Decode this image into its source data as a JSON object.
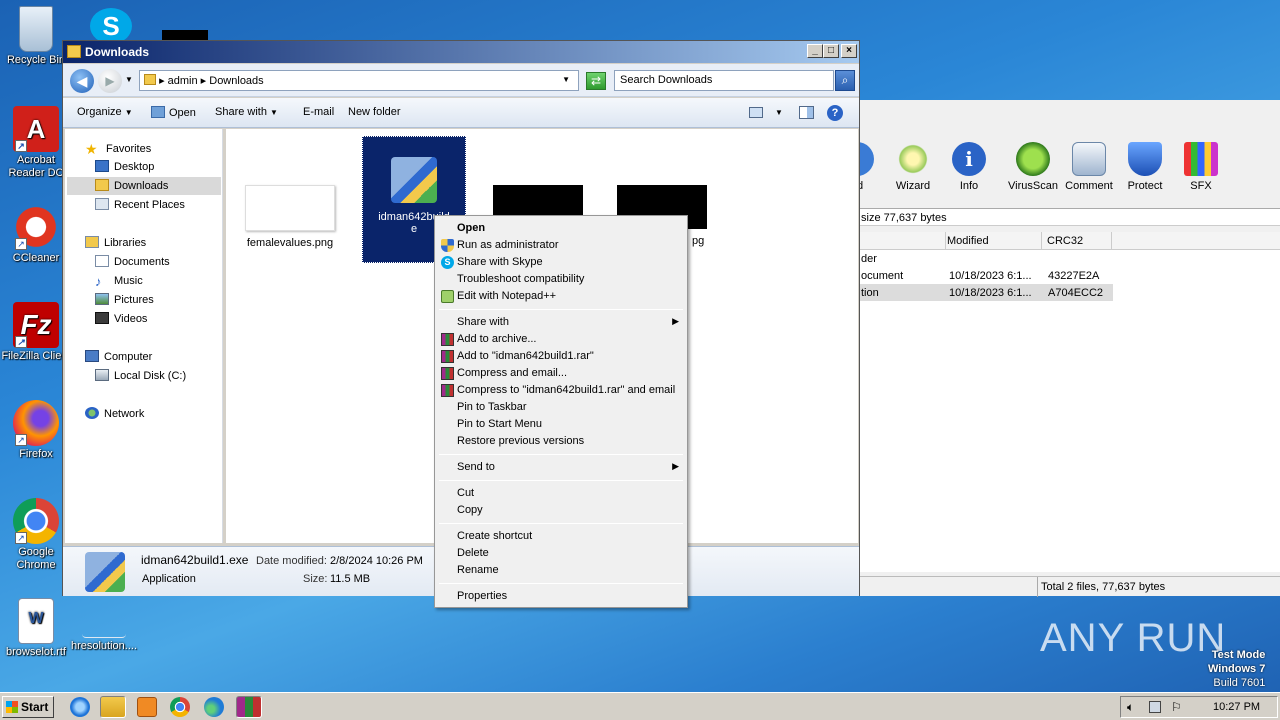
{
  "desktop": {
    "icons": [
      {
        "label": "Recycle Bin",
        "icon": "recycle-bin-icon"
      },
      {
        "label": "Acrobat Reader DC",
        "icon": "acrobat-icon"
      },
      {
        "label": "CCleaner",
        "icon": "ccleaner-icon"
      },
      {
        "label": "FileZilla Client",
        "icon": "filezilla-icon"
      },
      {
        "label": "Firefox",
        "icon": "firefox-icon"
      },
      {
        "label": "Google Chrome",
        "icon": "chrome-icon"
      },
      {
        "label": "browselot.rtf",
        "icon": "word-doc-icon"
      },
      {
        "label": "hresolution....",
        "icon": "blank-file-icon"
      }
    ]
  },
  "winrar": {
    "toolbar": [
      "ad",
      "Wizard",
      "Info",
      "VirusScan",
      "Comment",
      "Protect",
      "SFX"
    ],
    "path_text": "size 77,637 bytes",
    "columns": [
      "Modified",
      "CRC32"
    ],
    "rows": [
      {
        "name": "der",
        "modified": "",
        "crc": ""
      },
      {
        "name": "ocument",
        "modified": "10/18/2023 6:1...",
        "crc": "43227E2A"
      },
      {
        "name": "tion",
        "modified": "10/18/2023 6:1...",
        "crc": "A704ECC2"
      }
    ],
    "status": "Total 2 files, 77,637 bytes"
  },
  "explorer": {
    "title": "Downloads",
    "breadcrumb": [
      "admin",
      "Downloads"
    ],
    "search_placeholder": "Search Downloads",
    "commands": [
      "Organize",
      "Open",
      "Share with",
      "E-mail",
      "New folder"
    ],
    "nav": {
      "favorites": "Favorites",
      "desktop": "Desktop",
      "downloads": "Downloads",
      "recent": "Recent Places",
      "libraries": "Libraries",
      "documents": "Documents",
      "music": "Music",
      "pictures": "Pictures",
      "videos": "Videos",
      "computer": "Computer",
      "local_disk": "Local Disk (C:)",
      "network": "Network"
    },
    "files": [
      {
        "name": "femalevalues.png"
      },
      {
        "name": "idman642build1.exe",
        "line1": "idman642build",
        "line2": "e"
      },
      {
        "name": "pg"
      }
    ],
    "details": {
      "filename": "idman642build1.exe",
      "date_label": "Date modified:",
      "date_value": "2/8/2024 10:26 PM",
      "type": "Application",
      "size_label": "Size:",
      "size_value": "11.5 MB"
    }
  },
  "context_menu": {
    "open": "Open",
    "run_admin": "Run as administrator",
    "share_skype": "Share with Skype",
    "troubleshoot": "Troubleshoot compatibility",
    "notepad": "Edit with Notepad++",
    "share_with": "Share with",
    "add_archive": "Add to archive...",
    "add_rar": "Add to \"idman642build1.rar\"",
    "compress_email": "Compress and email...",
    "compress_rar_email": "Compress to \"idman642build1.rar\" and email",
    "pin_taskbar": "Pin to Taskbar",
    "pin_start": "Pin to Start Menu",
    "restore": "Restore previous versions",
    "send_to": "Send to",
    "cut": "Cut",
    "copy": "Copy",
    "create_shortcut": "Create shortcut",
    "delete": "Delete",
    "rename": "Rename",
    "properties": "Properties"
  },
  "taskbar": {
    "start": "Start",
    "clock": "10:27 PM"
  },
  "watermark": {
    "line1": "Test Mode",
    "line2": "Windows 7",
    "line3": "Build 7601",
    "brand": "ANY RUN"
  }
}
